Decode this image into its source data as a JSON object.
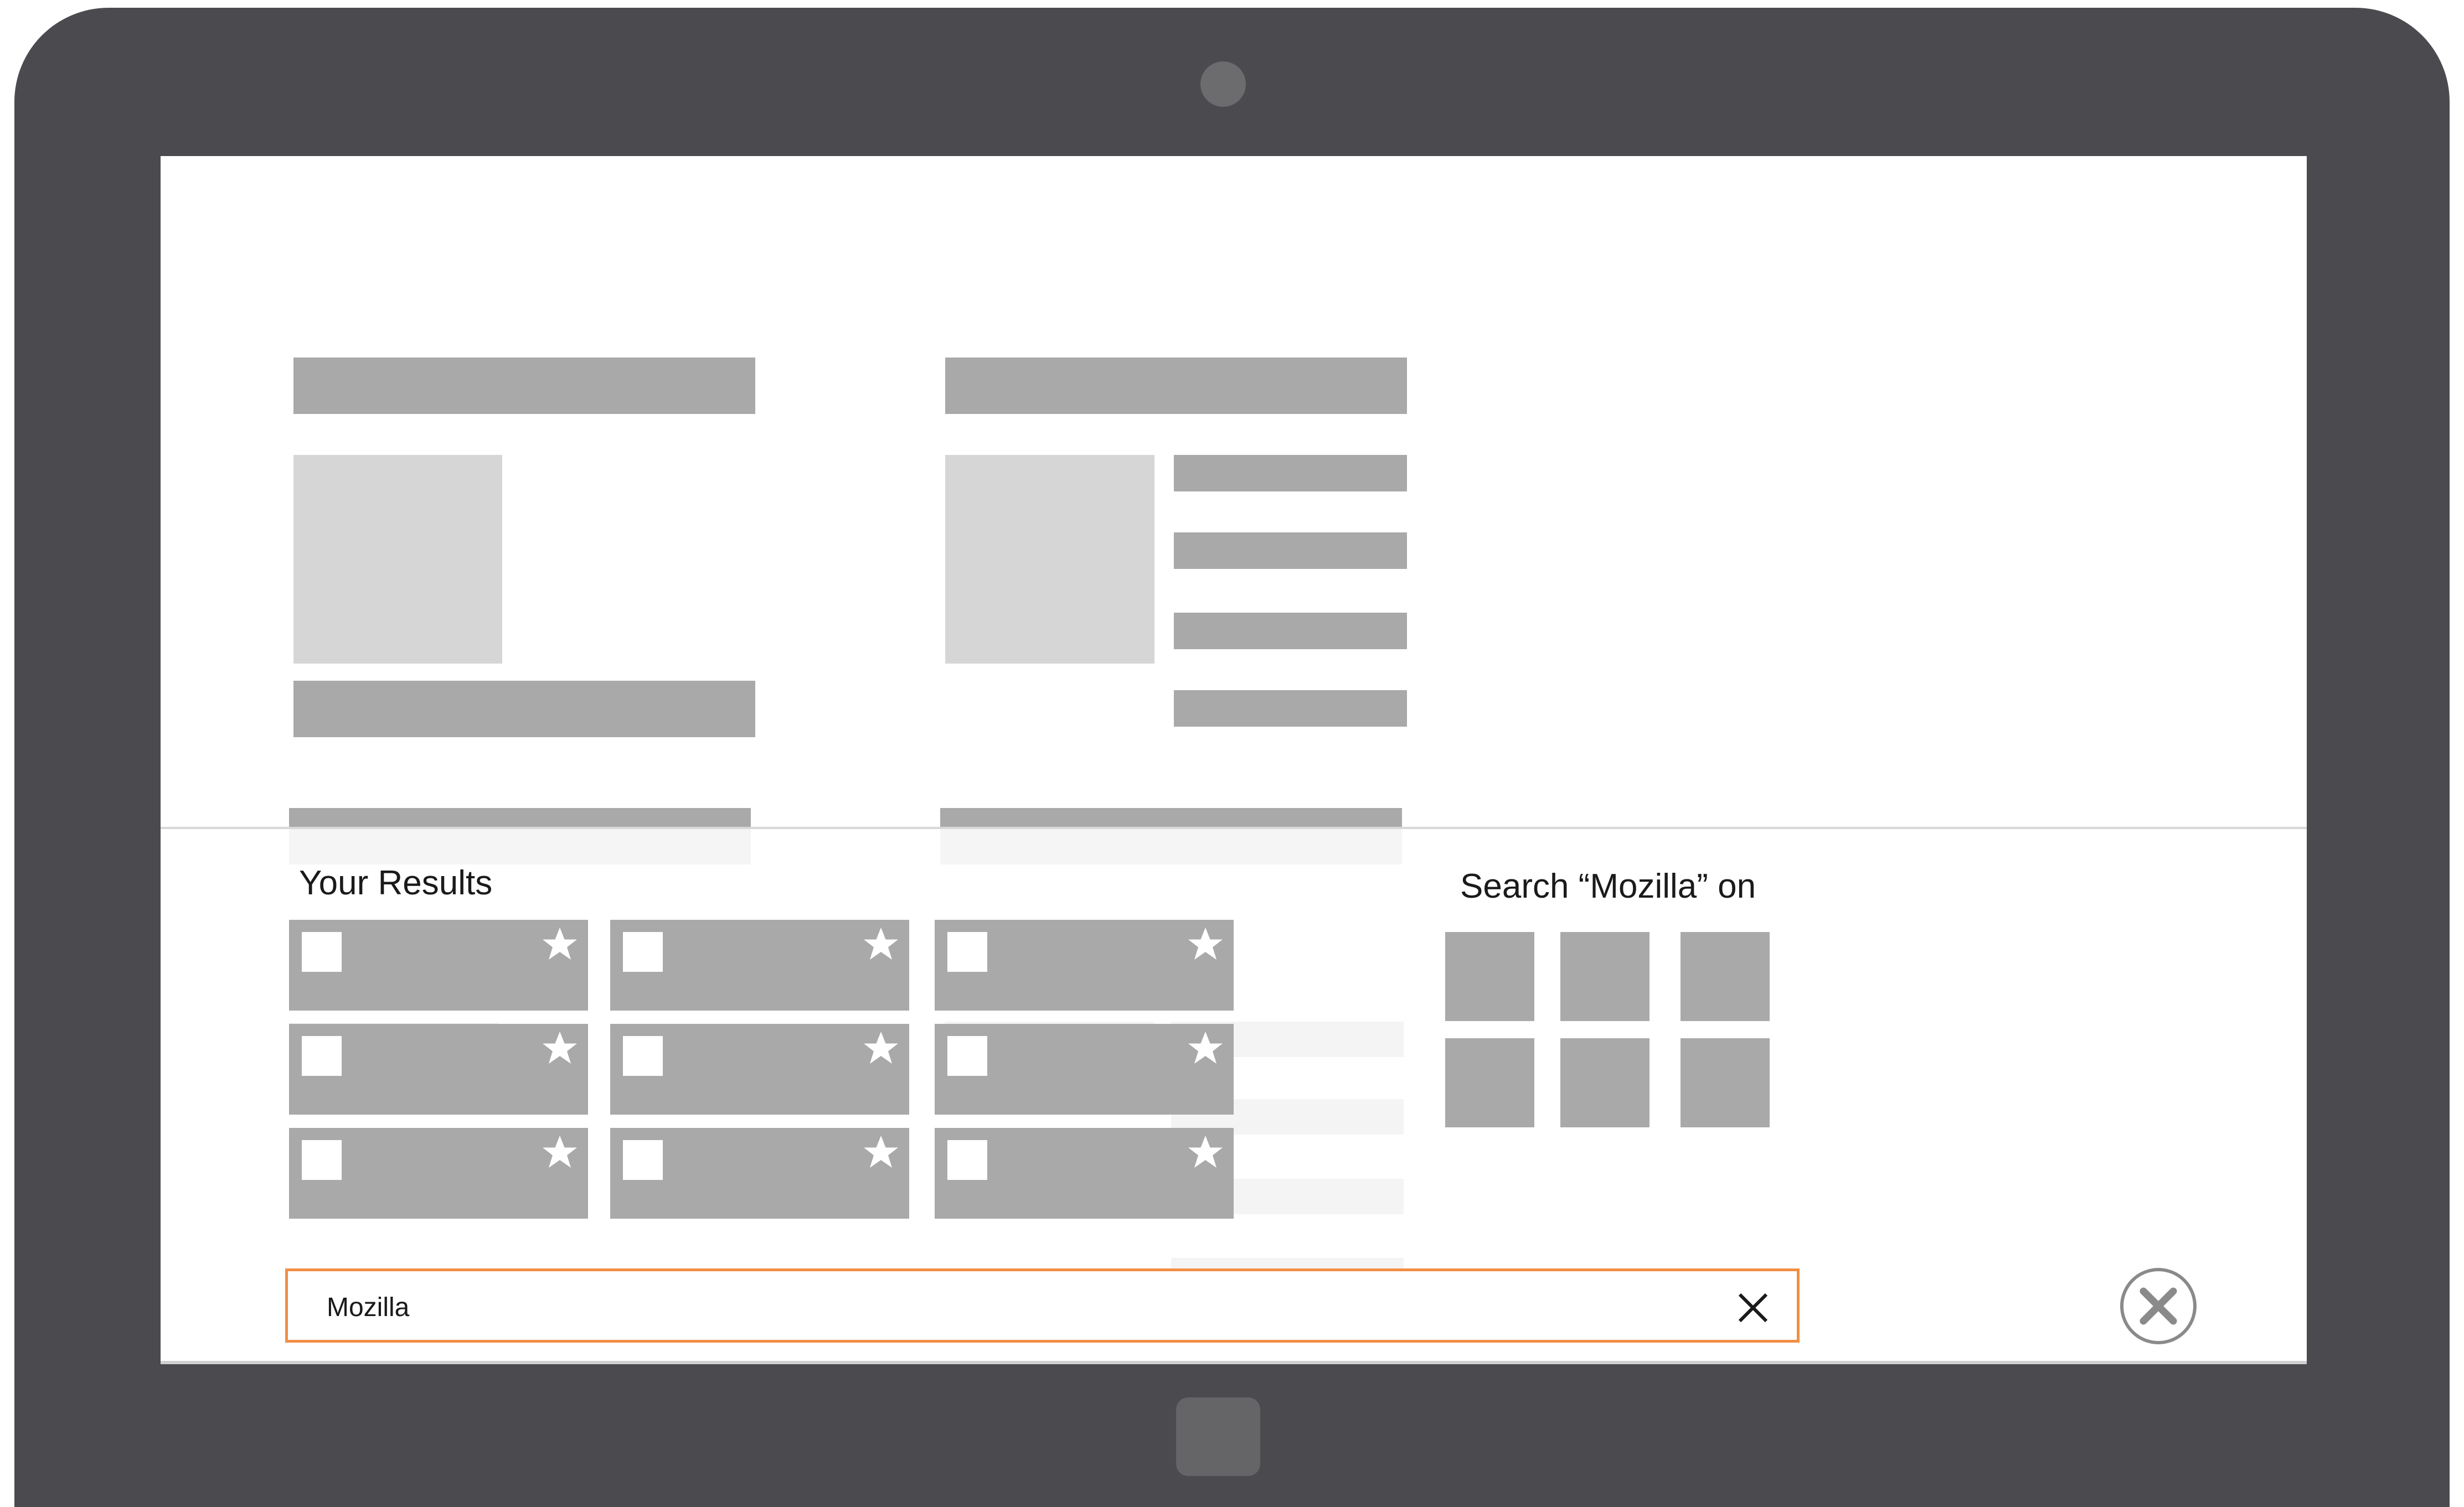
{
  "colors": {
    "device_frame": "#4a4a4f",
    "placeholder": "#a9a9a9",
    "accent_border": "#f28e45"
  },
  "results": {
    "title": "Your Results",
    "tiles": [
      {
        "thumb_icon": "thumbnail-icon",
        "star_icon": "star-icon"
      },
      {
        "thumb_icon": "thumbnail-icon",
        "star_icon": "star-icon"
      },
      {
        "thumb_icon": "thumbnail-icon",
        "star_icon": "star-icon"
      },
      {
        "thumb_icon": "thumbnail-icon",
        "star_icon": "star-icon"
      },
      {
        "thumb_icon": "thumbnail-icon",
        "star_icon": "star-icon"
      },
      {
        "thumb_icon": "thumbnail-icon",
        "star_icon": "star-icon"
      },
      {
        "thumb_icon": "thumbnail-icon",
        "star_icon": "star-icon"
      },
      {
        "thumb_icon": "thumbnail-icon",
        "star_icon": "star-icon"
      },
      {
        "thumb_icon": "thumbnail-icon",
        "star_icon": "star-icon"
      }
    ]
  },
  "providers": {
    "title": "Search “Mozilla” on",
    "count": 6
  },
  "search": {
    "value": "Mozilla",
    "clear_icon": "clear-x-icon",
    "close_icon": "close-circle-icon"
  }
}
